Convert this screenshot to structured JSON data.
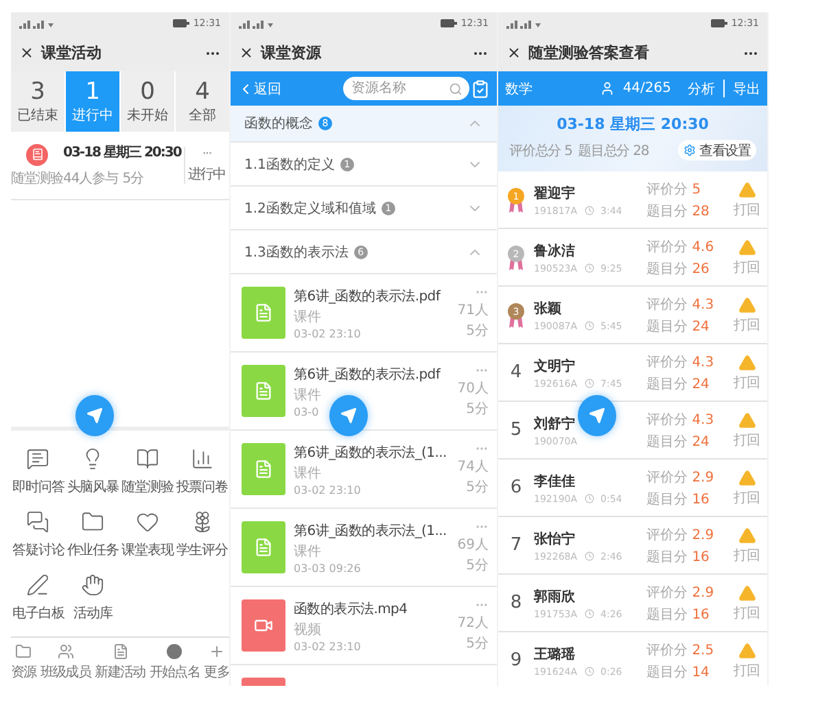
{
  "activity_screen": {
    "status_time": "12:31",
    "title": "课堂活动",
    "tabs": [
      {
        "count": "3",
        "label": "已结束",
        "selected": false
      },
      {
        "count": "1",
        "label": "进行中",
        "selected": true
      },
      {
        "count": "0",
        "label": "未开始",
        "selected": false
      },
      {
        "count": "4",
        "label": "全部",
        "selected": false
      }
    ],
    "activity": {
      "type_label": "随堂测验",
      "title": "03-18 星期三 20:30",
      "participants": "44人参与",
      "duration": "5分",
      "more": "···",
      "status": "进行中"
    },
    "tools": [
      {
        "kind": "message",
        "label": "即时问答"
      },
      {
        "kind": "bulb",
        "label": "头脑风暴"
      },
      {
        "kind": "book",
        "label": "随堂测验"
      },
      {
        "kind": "chart",
        "label": "投票问卷"
      },
      {
        "kind": "chat",
        "label": "答疑讨论"
      },
      {
        "kind": "folder",
        "label": "作业任务"
      },
      {
        "kind": "heart",
        "label": "课堂表现"
      },
      {
        "kind": "flower",
        "label": "学生评分"
      },
      {
        "kind": "pen",
        "label": "电子白板"
      },
      {
        "kind": "hand",
        "label": "活动库"
      }
    ],
    "bottom_bar": [
      {
        "kind": "folder",
        "label": "资源"
      },
      {
        "kind": "users",
        "label": "班级成员"
      },
      {
        "kind": "file",
        "label": "新建活动"
      },
      {
        "kind": "dot",
        "label": "开始点名"
      },
      {
        "kind": "plus",
        "label": "更多"
      }
    ]
  },
  "resource_screen": {
    "status_time": "12:31",
    "title": "课堂资源",
    "back": "返回",
    "search": {
      "placeholder": "资源名称"
    },
    "sections": [
      {
        "title": "函数的概念",
        "count": "8",
        "expanded": true,
        "selected": true
      },
      {
        "title": "1.1函数的定义",
        "count": "1",
        "expanded": false,
        "selected": false
      },
      {
        "title": "1.2函数定义域和值域",
        "count": "1",
        "expanded": false,
        "selected": false
      },
      {
        "title": "1.3函数的表示法",
        "count": "6",
        "expanded": true,
        "selected": false
      }
    ],
    "files": [
      {
        "kind": "document",
        "name": "第6讲_函数的表示法.pdf",
        "type": "课件",
        "date": "03-02 23:10",
        "views": "71人",
        "duration": "5分"
      },
      {
        "kind": "document",
        "name": "第6讲_函数的表示法.pdf",
        "type": "课件",
        "date": "03-0",
        "views": "70人",
        "duration": "5分"
      },
      {
        "kind": "document",
        "name": "第6讲_函数的表示法_(1...",
        "type": "课件",
        "date": "03-02 23:10",
        "views": "74人",
        "duration": "5分"
      },
      {
        "kind": "document",
        "name": "第6讲_函数的表示法_(1...",
        "type": "课件",
        "date": "03-03 09:26",
        "views": "69人",
        "duration": "5分"
      },
      {
        "kind": "video",
        "name": "函数的表示法.mp4",
        "type": "视频",
        "date": "03-02 23:10",
        "views": "72人",
        "duration": "5分"
      },
      {
        "kind": "video"
      }
    ]
  },
  "results_screen": {
    "status_time": "12:31",
    "title": "随堂测验答案查看",
    "subject": "数学",
    "submitted": "44/265",
    "analysis": "分析",
    "export": "导出",
    "date": "03-18 星期三 20:30",
    "total_rating": "评价总分 5",
    "total_score": "题目总分 28",
    "settings": "查看设置",
    "students": [
      {
        "rank": "1",
        "color": "#f5a623",
        "name": "翟迎宇",
        "id": "191817A",
        "time": "3:44",
        "rating_label": "评价分",
        "rating": "5",
        "score_label": "题目分",
        "score": "28",
        "action": "打回"
      },
      {
        "rank": "2",
        "color": "#b8b8b8",
        "name": "鲁冰洁",
        "id": "190523A",
        "time": "9:25",
        "rating_label": "评价分",
        "rating": "4.6",
        "score_label": "题目分",
        "score": "26",
        "action": "打回"
      },
      {
        "rank": "3",
        "color": "#b0875a",
        "name": "张颖",
        "id": "190087A",
        "time": "5:45",
        "rating_label": "评价分",
        "rating": "4.3",
        "score_label": "题目分",
        "score": "24",
        "action": "打回"
      },
      {
        "rank": "4",
        "name": "文明宁",
        "id": "192616A",
        "time": "7:45",
        "rating_label": "评价分",
        "rating": "4.3",
        "score_label": "题目分",
        "score": "24",
        "action": "打回"
      },
      {
        "rank": "5",
        "name": "刘舒宁",
        "id": "190070A",
        "rating_label": "评价分",
        "rating": "4.3",
        "score_label": "题目分",
        "score": "24",
        "action": "打回"
      },
      {
        "rank": "6",
        "name": "李佳佳",
        "id": "192190A",
        "time": "0:54",
        "rating_label": "评价分",
        "rating": "2.9",
        "score_label": "题目分",
        "score": "16",
        "action": "打回"
      },
      {
        "rank": "7",
        "name": "张怡宁",
        "id": "192268A",
        "time": "2:46",
        "rating_label": "评价分",
        "rating": "2.9",
        "score_label": "题目分",
        "score": "16",
        "action": "打回"
      },
      {
        "rank": "8",
        "name": "郭雨欣",
        "id": "191753A",
        "time": "4:26",
        "rating_label": "评价分",
        "rating": "2.9",
        "score_label": "题目分",
        "score": "16",
        "action": "打回"
      },
      {
        "rank": "9",
        "name": "王璐瑶",
        "id": "191624A",
        "time": "0:26",
        "rating_label": "评价分",
        "rating": "2.5",
        "score_label": "题目分",
        "score": "14",
        "action": "打回"
      }
    ]
  }
}
